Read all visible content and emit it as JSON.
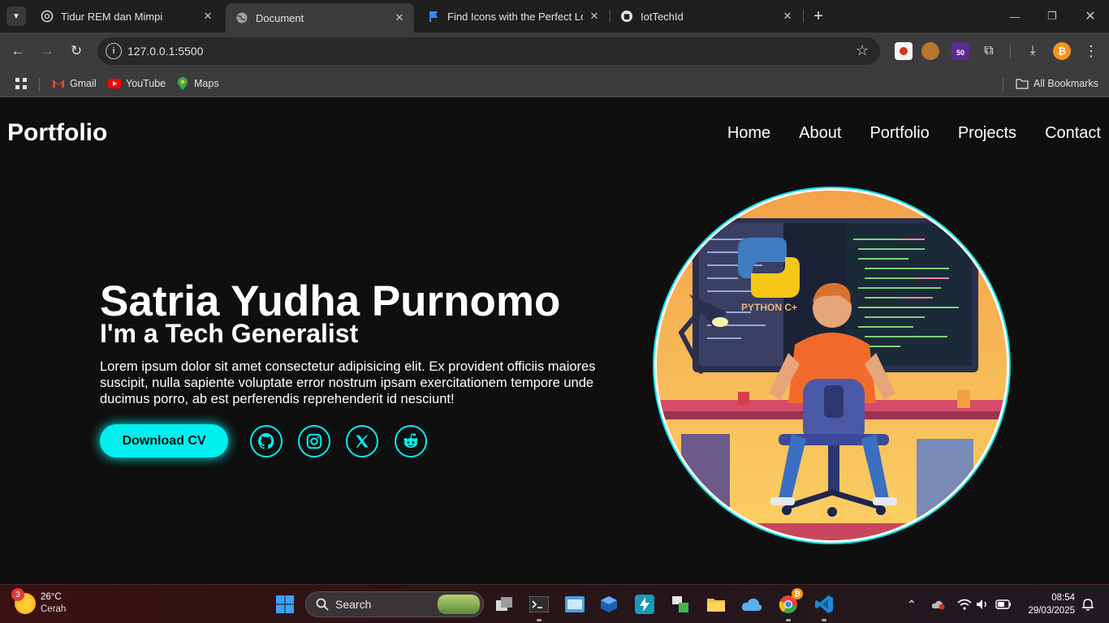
{
  "browser": {
    "tabs": [
      {
        "title": "Tidur REM dan Mimpi",
        "icon": "chatgpt-icon",
        "active": false
      },
      {
        "title": "Document",
        "icon": "globe-icon",
        "active": true
      },
      {
        "title": "Find Icons with the Perfect Look",
        "icon": "flag-icon",
        "active": false
      },
      {
        "title": "IotTechId",
        "icon": "github-icon",
        "active": false
      }
    ],
    "url": "127.0.0.1:5500",
    "bookmarks": [
      {
        "label": "Gmail",
        "icon": "gmail-icon"
      },
      {
        "label": "YouTube",
        "icon": "youtube-icon"
      },
      {
        "label": "Maps",
        "icon": "maps-icon"
      }
    ],
    "all_bookmarks": "All Bookmarks",
    "extension_badge": "50"
  },
  "site": {
    "brand": "Portfolio",
    "nav": [
      "Home",
      "About",
      "Portfolio",
      "Projects",
      "Contact"
    ],
    "hero": {
      "name": "Satria Yudha Purnomo",
      "subtitle": "I'm a Tech Generalist",
      "description": "Lorem ipsum dolor sit amet consectetur adipisicing elit. Ex provident officiis maiores suscipit, nulla sapiente voluptate error nostrum ipsam exercitationem tempore unde ducimus porro, ab est perferendis reprehenderit id nesciunt!",
      "cta": "Download CV",
      "socials": [
        "github-icon",
        "instagram-icon",
        "x-twitter-icon",
        "reddit-icon"
      ]
    },
    "illustration": {
      "screen_text": "PYTHON C+"
    },
    "accent_color": "#00f0f0"
  },
  "taskbar": {
    "weather": {
      "temp": "26°C",
      "condition": "Cerah",
      "badge": "3"
    },
    "search_label": "Search",
    "chrome_badge": "₿",
    "time": "08:54",
    "date": "29/03/2025"
  }
}
